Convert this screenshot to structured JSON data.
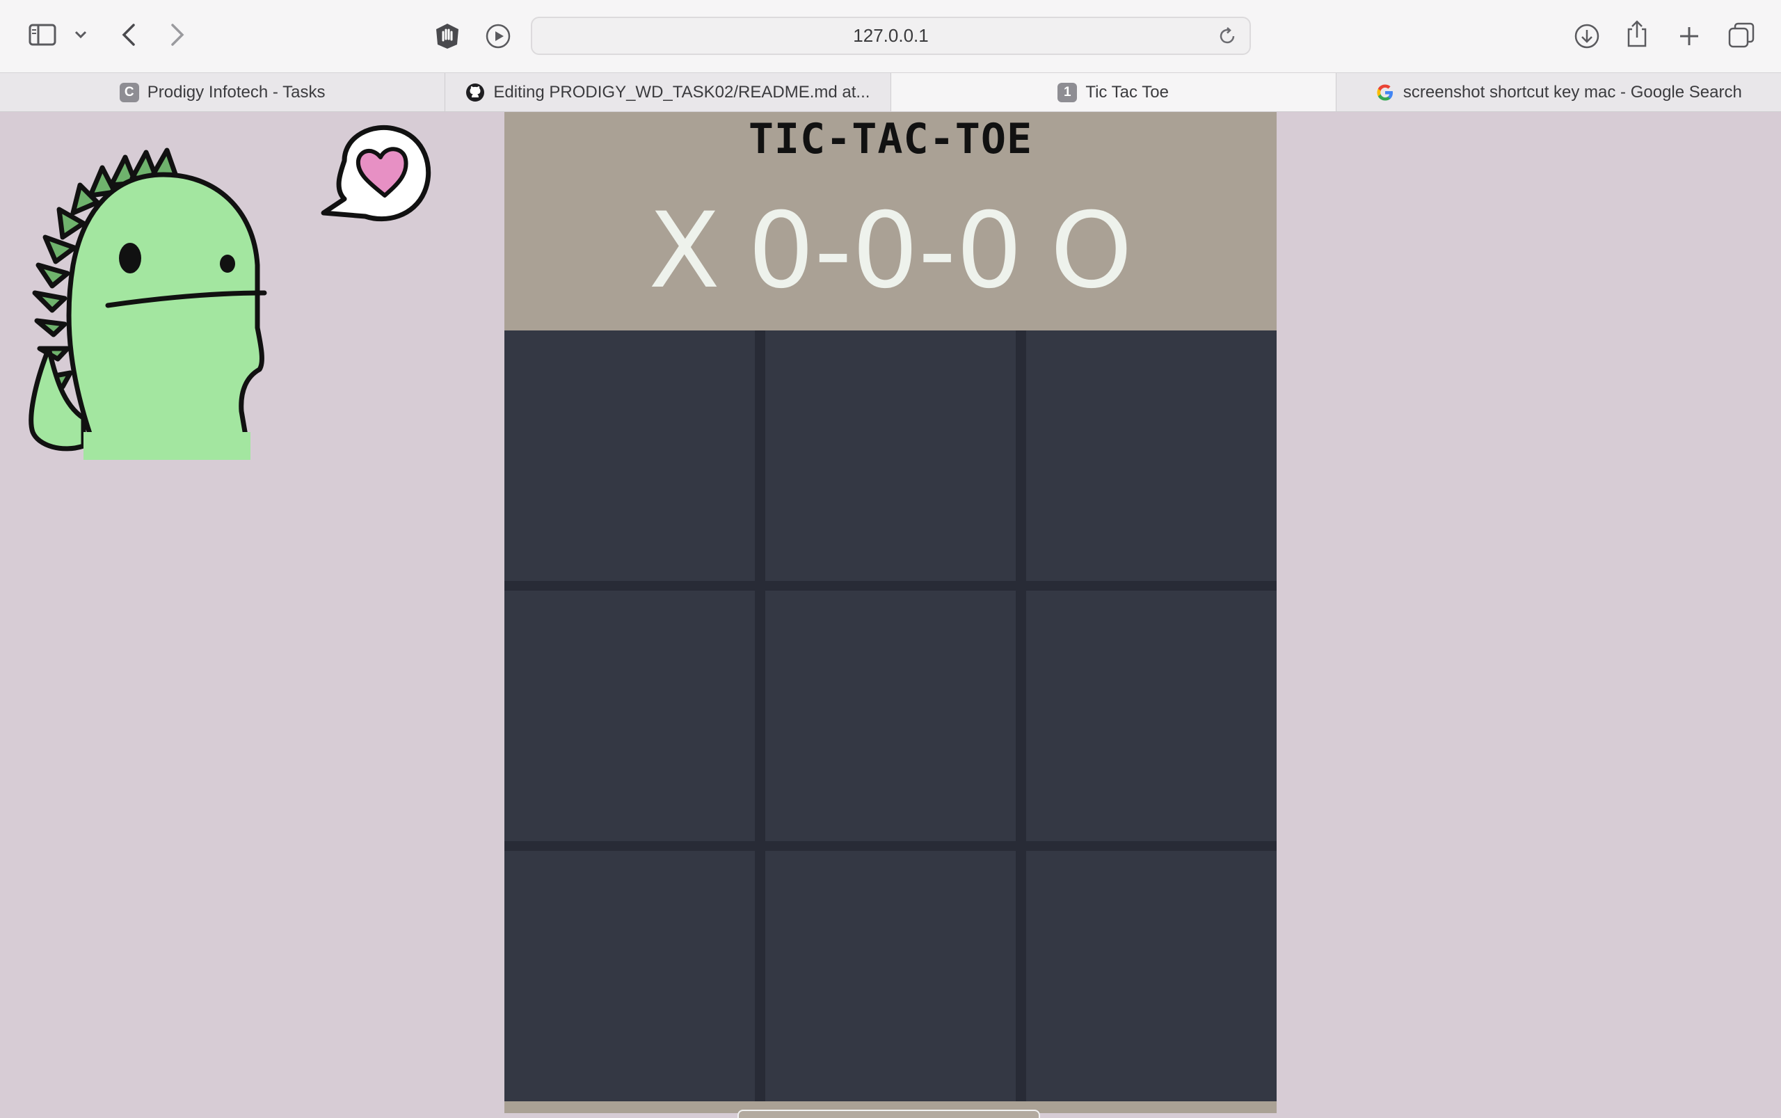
{
  "browser": {
    "url": "127.0.0.1",
    "tabs": [
      {
        "label": "Prodigy Infotech - Tasks",
        "favicon": "C",
        "active": false
      },
      {
        "label": "Editing PRODIGY_WD_TASK02/README.md at...",
        "favicon": "github-icon",
        "active": false
      },
      {
        "label": "Tic Tac Toe",
        "favicon": "1",
        "active": true
      },
      {
        "label": "screenshot shortcut key mac - Google Search",
        "favicon": "google-icon",
        "active": false
      }
    ]
  },
  "game": {
    "title": "TIC-TAC-TOE",
    "score": {
      "player_x": "X",
      "x_wins": "0",
      "draws": "0",
      "o_wins": "0",
      "player_o": "O",
      "separator": "-"
    },
    "board": [
      "",
      "",
      "",
      "",
      "",
      "",
      "",
      "",
      ""
    ]
  },
  "colors": {
    "page_bg": "#d7ccd5",
    "header_bg": "#aaa195",
    "cell_bg": "#343844",
    "grid_line": "#282b36",
    "score_text": "#eef2ec",
    "dino_green": "#a3e6a0"
  }
}
